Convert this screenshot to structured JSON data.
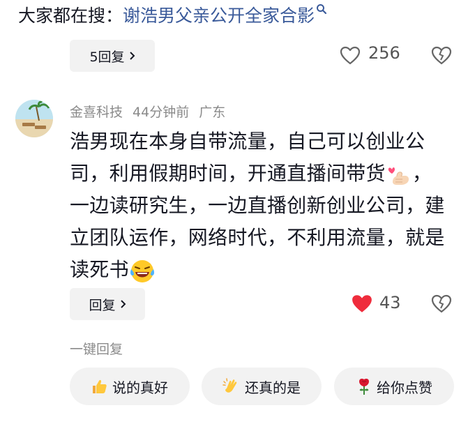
{
  "search": {
    "prefix": "大家都在搜：",
    "term": "谢浩男父亲公开全家合影",
    "icon": "search-icon"
  },
  "prev_comment": {
    "replies_label": "5回复",
    "likes": "256"
  },
  "comment": {
    "username": "金喜科技",
    "time": "44分钟前",
    "location": "广东",
    "text_part1": "浩男现在本身自带流量，自己可以创业公司，利用假期时间，开通直播间带货",
    "text_part2": "，一边读研究生，一边直播创新创业公司，建立团队运作，网络时代，不利用流量，就是读死书",
    "reply_label": "回复",
    "likes": "43",
    "like_color": "#ef2c3c"
  },
  "quick_reply": {
    "label": "一键回复",
    "chips": [
      {
        "icon": "thumbs-up-icon",
        "text": "说的真好"
      },
      {
        "icon": "clapping-hands-icon",
        "text": "还真的是"
      },
      {
        "icon": "rose-icon",
        "text": "给你点赞"
      }
    ]
  }
}
